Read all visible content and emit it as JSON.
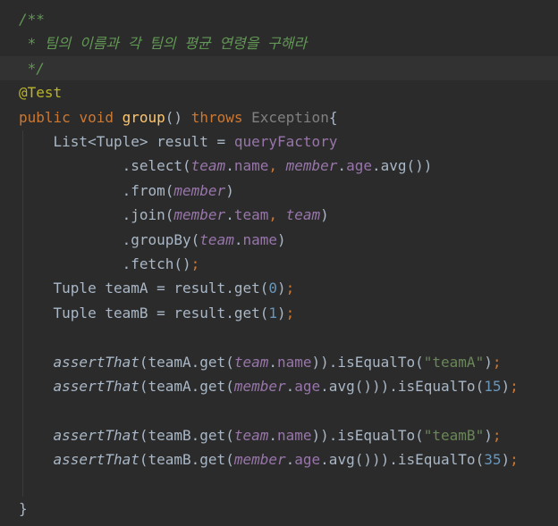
{
  "editor": {
    "lines": [
      {
        "current": false,
        "tokens": [
          {
            "t": "/**",
            "c": "comment"
          }
        ]
      },
      {
        "current": false,
        "tokens": [
          {
            "t": " * 팀의 이름과 각 팀의 평균 연령을 구해라",
            "c": "comment"
          }
        ]
      },
      {
        "current": true,
        "tokens": [
          {
            "t": " */",
            "c": "comment"
          }
        ]
      },
      {
        "current": false,
        "tokens": [
          {
            "t": "@Test",
            "c": "ann"
          }
        ]
      },
      {
        "current": false,
        "tokens": [
          {
            "t": "public ",
            "c": "kw"
          },
          {
            "t": "void ",
            "c": "kw"
          },
          {
            "t": "group",
            "c": "method"
          },
          {
            "t": "() ",
            "c": "plain"
          },
          {
            "t": "throws ",
            "c": "kw"
          },
          {
            "t": "Exception",
            "c": "exc"
          },
          {
            "t": "{",
            "c": "plain"
          }
        ]
      },
      {
        "current": false,
        "tokens": [
          {
            "t": "    List<Tuple> result = ",
            "c": "plain"
          },
          {
            "t": "queryFactory",
            "c": "field"
          }
        ]
      },
      {
        "current": false,
        "tokens": [
          {
            "t": "            .select(",
            "c": "plain"
          },
          {
            "t": "team",
            "c": "static"
          },
          {
            "t": ".",
            "c": "plain"
          },
          {
            "t": "name",
            "c": "field"
          },
          {
            "t": ", ",
            "c": "kw"
          },
          {
            "t": "member",
            "c": "static"
          },
          {
            "t": ".",
            "c": "plain"
          },
          {
            "t": "age",
            "c": "field"
          },
          {
            "t": ".avg())",
            "c": "plain"
          }
        ]
      },
      {
        "current": false,
        "tokens": [
          {
            "t": "            .from(",
            "c": "plain"
          },
          {
            "t": "member",
            "c": "static"
          },
          {
            "t": ")",
            "c": "plain"
          }
        ]
      },
      {
        "current": false,
        "tokens": [
          {
            "t": "            .join(",
            "c": "plain"
          },
          {
            "t": "member",
            "c": "static"
          },
          {
            "t": ".",
            "c": "plain"
          },
          {
            "t": "team",
            "c": "field"
          },
          {
            "t": ", ",
            "c": "kw"
          },
          {
            "t": "team",
            "c": "static"
          },
          {
            "t": ")",
            "c": "plain"
          }
        ]
      },
      {
        "current": false,
        "tokens": [
          {
            "t": "            .groupBy(",
            "c": "plain"
          },
          {
            "t": "team",
            "c": "static"
          },
          {
            "t": ".",
            "c": "plain"
          },
          {
            "t": "name",
            "c": "field"
          },
          {
            "t": ")",
            "c": "plain"
          }
        ]
      },
      {
        "current": false,
        "tokens": [
          {
            "t": "            .fetch()",
            "c": "plain"
          },
          {
            "t": ";",
            "c": "kw"
          }
        ]
      },
      {
        "current": false,
        "tokens": [
          {
            "t": "    Tuple teamA = result.get(",
            "c": "plain"
          },
          {
            "t": "0",
            "c": "num"
          },
          {
            "t": ")",
            "c": "plain"
          },
          {
            "t": ";",
            "c": "kw"
          }
        ]
      },
      {
        "current": false,
        "tokens": [
          {
            "t": "    Tuple teamB = result.get(",
            "c": "plain"
          },
          {
            "t": "1",
            "c": "num"
          },
          {
            "t": ")",
            "c": "plain"
          },
          {
            "t": ";",
            "c": "kw"
          }
        ]
      },
      {
        "current": false,
        "tokens": []
      },
      {
        "current": false,
        "tokens": [
          {
            "t": "    ",
            "c": "plain"
          },
          {
            "t": "assertThat",
            "c": "call"
          },
          {
            "t": "(teamA.get(",
            "c": "plain"
          },
          {
            "t": "team",
            "c": "static"
          },
          {
            "t": ".",
            "c": "plain"
          },
          {
            "t": "name",
            "c": "field"
          },
          {
            "t": ")).isEqualTo(",
            "c": "plain"
          },
          {
            "t": "\"teamA\"",
            "c": "str"
          },
          {
            "t": ")",
            "c": "plain"
          },
          {
            "t": ";",
            "c": "kw"
          }
        ]
      },
      {
        "current": false,
        "tokens": [
          {
            "t": "    ",
            "c": "plain"
          },
          {
            "t": "assertThat",
            "c": "call"
          },
          {
            "t": "(teamA.get(",
            "c": "plain"
          },
          {
            "t": "member",
            "c": "static"
          },
          {
            "t": ".",
            "c": "plain"
          },
          {
            "t": "age",
            "c": "field"
          },
          {
            "t": ".avg())).isEqualTo(",
            "c": "plain"
          },
          {
            "t": "15",
            "c": "num"
          },
          {
            "t": ")",
            "c": "plain"
          },
          {
            "t": ";",
            "c": "kw"
          }
        ]
      },
      {
        "current": false,
        "tokens": []
      },
      {
        "current": false,
        "tokens": [
          {
            "t": "    ",
            "c": "plain"
          },
          {
            "t": "assertThat",
            "c": "call"
          },
          {
            "t": "(teamB.get(",
            "c": "plain"
          },
          {
            "t": "team",
            "c": "static"
          },
          {
            "t": ".",
            "c": "plain"
          },
          {
            "t": "name",
            "c": "field"
          },
          {
            "t": ")).isEqualTo(",
            "c": "plain"
          },
          {
            "t": "\"teamB\"",
            "c": "str"
          },
          {
            "t": ")",
            "c": "plain"
          },
          {
            "t": ";",
            "c": "kw"
          }
        ]
      },
      {
        "current": false,
        "tokens": [
          {
            "t": "    ",
            "c": "plain"
          },
          {
            "t": "assertThat",
            "c": "call"
          },
          {
            "t": "(teamB.get(",
            "c": "plain"
          },
          {
            "t": "member",
            "c": "static"
          },
          {
            "t": ".",
            "c": "plain"
          },
          {
            "t": "age",
            "c": "field"
          },
          {
            "t": ".avg())).isEqualTo(",
            "c": "plain"
          },
          {
            "t": "35",
            "c": "num"
          },
          {
            "t": ")",
            "c": "plain"
          },
          {
            "t": ";",
            "c": "kw"
          }
        ]
      },
      {
        "current": false,
        "tokens": []
      },
      {
        "current": false,
        "tokens": [
          {
            "t": "}",
            "c": "plain"
          }
        ]
      }
    ]
  }
}
